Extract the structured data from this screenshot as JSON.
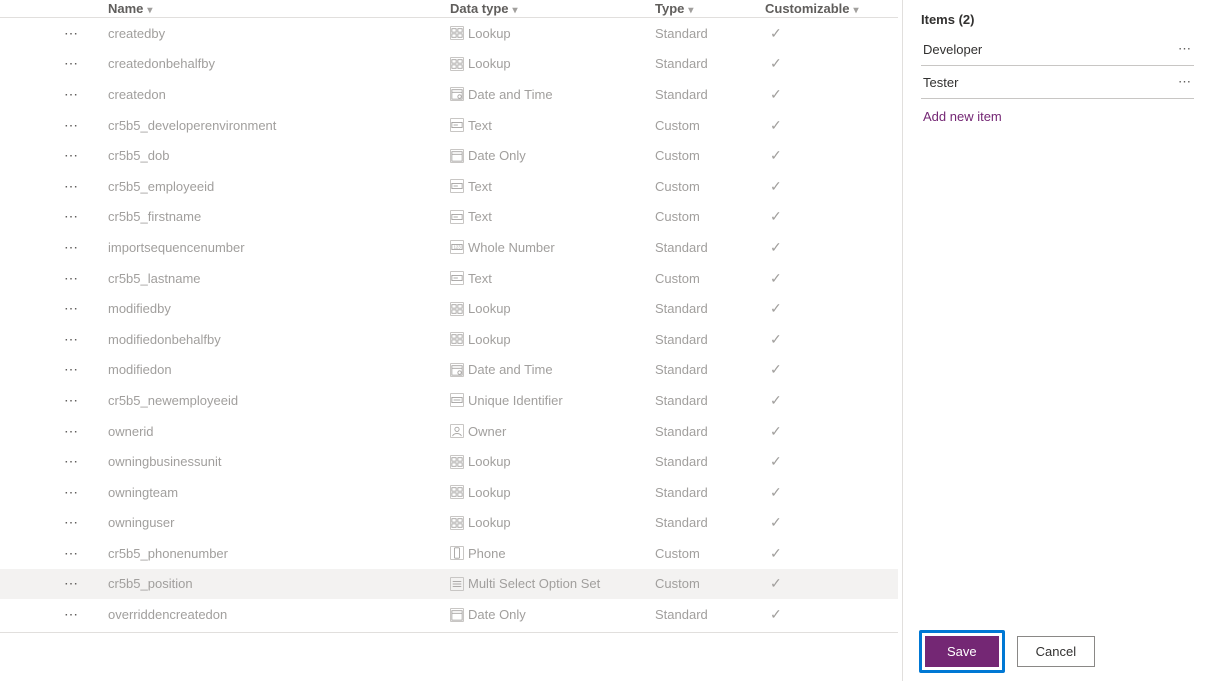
{
  "headers": {
    "name": "Name",
    "datatype": "Data type",
    "type": "Type",
    "customizable": "Customizable"
  },
  "rows": [
    {
      "name": "createdby",
      "datatype": "Lookup",
      "icon": "lookup",
      "type": "Standard",
      "check": true
    },
    {
      "name": "createdonbehalfby",
      "datatype": "Lookup",
      "icon": "lookup",
      "type": "Standard",
      "check": true
    },
    {
      "name": "createdon",
      "datatype": "Date and Time",
      "icon": "datetime",
      "type": "Standard",
      "check": true
    },
    {
      "name": "cr5b5_developerenvironment",
      "datatype": "Text",
      "icon": "text",
      "type": "Custom",
      "check": true
    },
    {
      "name": "cr5b5_dob",
      "datatype": "Date Only",
      "icon": "date",
      "type": "Custom",
      "check": true
    },
    {
      "name": "cr5b5_employeeid",
      "datatype": "Text",
      "icon": "text",
      "type": "Custom",
      "check": true
    },
    {
      "name": "cr5b5_firstname",
      "datatype": "Text",
      "icon": "text",
      "type": "Custom",
      "check": true
    },
    {
      "name": "importsequencenumber",
      "datatype": "Whole Number",
      "icon": "number",
      "type": "Standard",
      "check": true
    },
    {
      "name": "cr5b5_lastname",
      "datatype": "Text",
      "icon": "text",
      "type": "Custom",
      "check": true
    },
    {
      "name": "modifiedby",
      "datatype": "Lookup",
      "icon": "lookup",
      "type": "Standard",
      "check": true
    },
    {
      "name": "modifiedonbehalfby",
      "datatype": "Lookup",
      "icon": "lookup",
      "type": "Standard",
      "check": true
    },
    {
      "name": "modifiedon",
      "datatype": "Date and Time",
      "icon": "datetime",
      "type": "Standard",
      "check": true
    },
    {
      "name": "cr5b5_newemployeeid",
      "datatype": "Unique Identifier",
      "icon": "unique",
      "type": "Standard",
      "check": true
    },
    {
      "name": "ownerid",
      "datatype": "Owner",
      "icon": "owner",
      "type": "Standard",
      "check": true
    },
    {
      "name": "owningbusinessunit",
      "datatype": "Lookup",
      "icon": "lookup",
      "type": "Standard",
      "check": true
    },
    {
      "name": "owningteam",
      "datatype": "Lookup",
      "icon": "lookup",
      "type": "Standard",
      "check": true
    },
    {
      "name": "owninguser",
      "datatype": "Lookup",
      "icon": "lookup",
      "type": "Standard",
      "check": true
    },
    {
      "name": "cr5b5_phonenumber",
      "datatype": "Phone",
      "icon": "phone",
      "type": "Custom",
      "check": true
    },
    {
      "name": "cr5b5_position",
      "datatype": "Multi Select Option Set",
      "icon": "multiselect",
      "type": "Custom",
      "check": true,
      "selected": true
    },
    {
      "name": "overriddencreatedon",
      "datatype": "Date Only",
      "icon": "date",
      "type": "Standard",
      "check": true
    }
  ],
  "panel": {
    "header": "Items (2)",
    "items": [
      "Developer",
      "Tester"
    ],
    "add_label": "Add new item"
  },
  "buttons": {
    "save": "Save",
    "cancel": "Cancel"
  }
}
